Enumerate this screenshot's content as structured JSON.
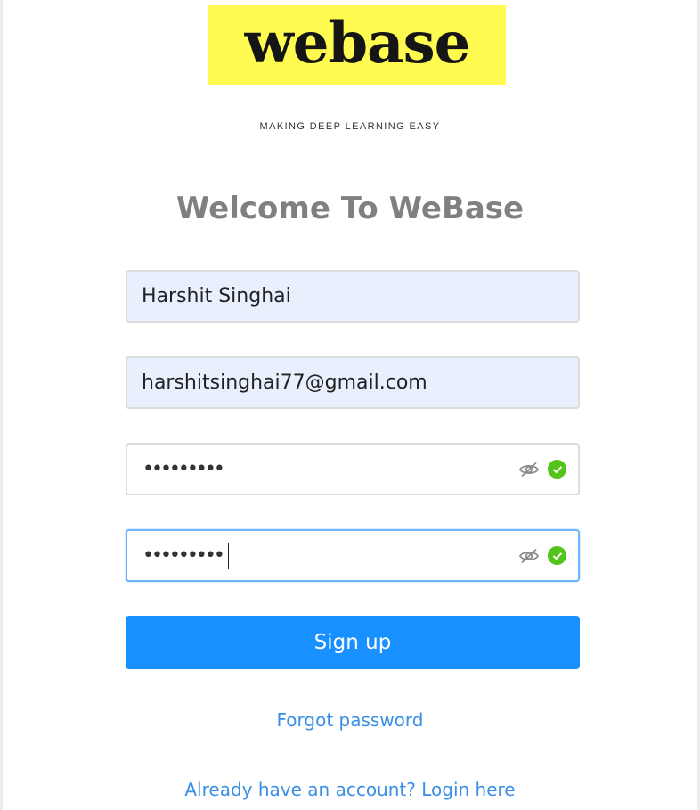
{
  "logo": {
    "text": "webase",
    "background": "#fffb50"
  },
  "tagline": "MAKING DEEP LEARNING EASY",
  "title": "Welcome To WeBase",
  "form": {
    "name": {
      "value": "Harshit Singhai"
    },
    "email": {
      "value": "harshitsinghai77@gmail.com"
    },
    "password": {
      "mask": "•••••••••",
      "visibility_icon": "eye-hidden-icon",
      "status_icon": "check-circle-icon"
    },
    "confirm_password": {
      "mask": "•••••••••",
      "visibility_icon": "eye-hidden-icon",
      "status_icon": "check-circle-icon"
    },
    "submit_label": "Sign up"
  },
  "links": {
    "forgot_password": "Forgot password",
    "login": "Already have an account? Login here"
  },
  "colors": {
    "primary": "#1890ff",
    "link": "#3a8ee6",
    "success": "#52c41a",
    "title": "#808080",
    "autofill": "#e8f0fe"
  }
}
